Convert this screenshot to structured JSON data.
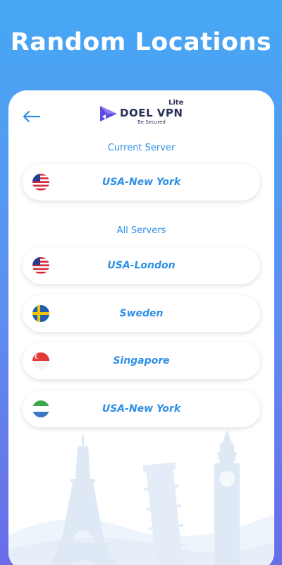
{
  "headline": "Random Locations",
  "logo": {
    "name_part1": "DOEL",
    "name_part2": "VPN",
    "badge": "Lite",
    "tagline": "Be Secured"
  },
  "current_server": {
    "title": "Current Server",
    "server": {
      "name": "USA-New York",
      "flag": "usa-flag-icon"
    }
  },
  "all_servers": {
    "title": "All Servers",
    "servers": [
      {
        "name": "USA-London",
        "flag": "usa-flag-icon"
      },
      {
        "name": "Sweden",
        "flag": "sweden-flag-icon"
      },
      {
        "name": "Singapore",
        "flag": "singapore-flag-icon"
      },
      {
        "name": "USA-New York",
        "flag": "sierra-leone-flag-icon"
      }
    ]
  },
  "colors": {
    "accent": "#2f8fe6",
    "background_top": "#46a8f4",
    "background_bottom": "#6a6ce8"
  }
}
